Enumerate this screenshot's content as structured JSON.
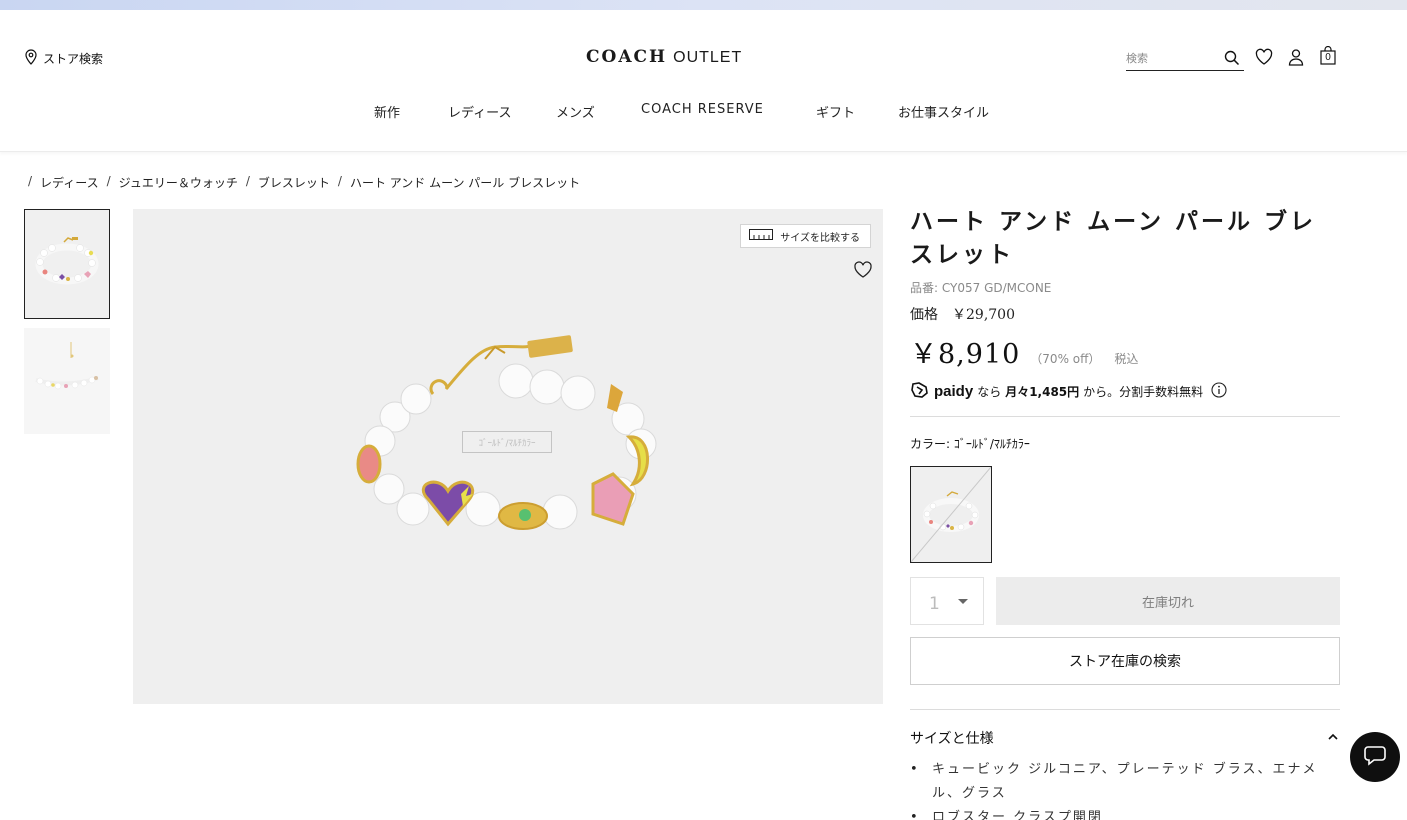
{
  "header": {
    "store_search": "ストア検索",
    "logo_brand": "COACH",
    "logo_outlet": "OUTLET",
    "search_placeholder": "検索",
    "cart_count": "0"
  },
  "nav": [
    "新作",
    "レディース",
    "メンズ",
    "COACH RESERVE",
    "ギフト",
    "お仕事スタイル"
  ],
  "breadcrumb": [
    "レディース",
    "ジュエリー＆ウォッチ",
    "ブレスレット",
    "ハート アンド ムーン パール ブレスレット"
  ],
  "gallery": {
    "compare_label": "サイズを比較する",
    "watermark": "ｺﾞｰﾙﾄﾞ/ﾏﾙﾁｶﾗｰ"
  },
  "product": {
    "title": "ハート アンド ムーン パール ブレスレット",
    "sku": "品番: CY057 GD/MCONE",
    "list_price": "価格　￥29,700",
    "sale_price": "￥8,910",
    "discount": "（70% off）",
    "tax": "税込",
    "paidy_logo": "paidy",
    "paidy_text_pre": "なら",
    "paidy_text_bold": "月々1,485円",
    "paidy_text_post": "から。分割手数料無料",
    "color_label": "カラー: ｺﾞｰﾙﾄﾞ/ﾏﾙﾁｶﾗｰ",
    "quantity": "1",
    "sold_out": "在庫切れ",
    "store_stock_button": "ストア在庫の検索",
    "spec_title": "サイズと仕様",
    "specs": [
      "キュービック ジルコニア、プレーテッド ブラス、エナメル、グラス",
      "ロブスター クラスプ開閉"
    ]
  },
  "colors": {
    "accent": "#111111",
    "hero_bg": "#efefef",
    "sold_out_bg": "#ececec",
    "header_strip": "#c9d6f2"
  }
}
